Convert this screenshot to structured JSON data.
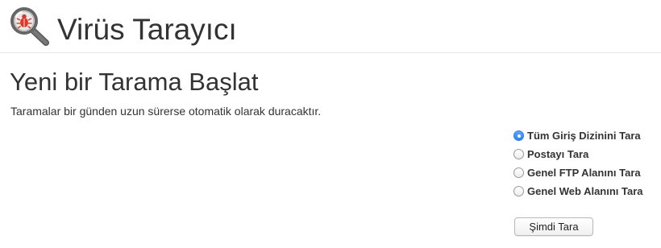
{
  "header": {
    "title": "Virüs Tarayıcı",
    "icon": "virus-scanner-magnifier-icon"
  },
  "scan": {
    "title": "Yeni bir Tarama Başlat",
    "description": "Taramalar bir günden uzun sürerse otomatik olarak duracaktır.",
    "options": [
      {
        "label": "Tüm Giriş Dizinini Tara",
        "selected": true
      },
      {
        "label": "Postayı Tara",
        "selected": false
      },
      {
        "label": "Genel FTP Alanını Tara",
        "selected": false
      },
      {
        "label": "Genel Web Alanını Tara",
        "selected": false
      }
    ],
    "button_label": "Şimdi Tara"
  },
  "colors": {
    "radio_selected": "#2f82ee",
    "bug_icon": "#d93b2b",
    "text": "#333333"
  }
}
